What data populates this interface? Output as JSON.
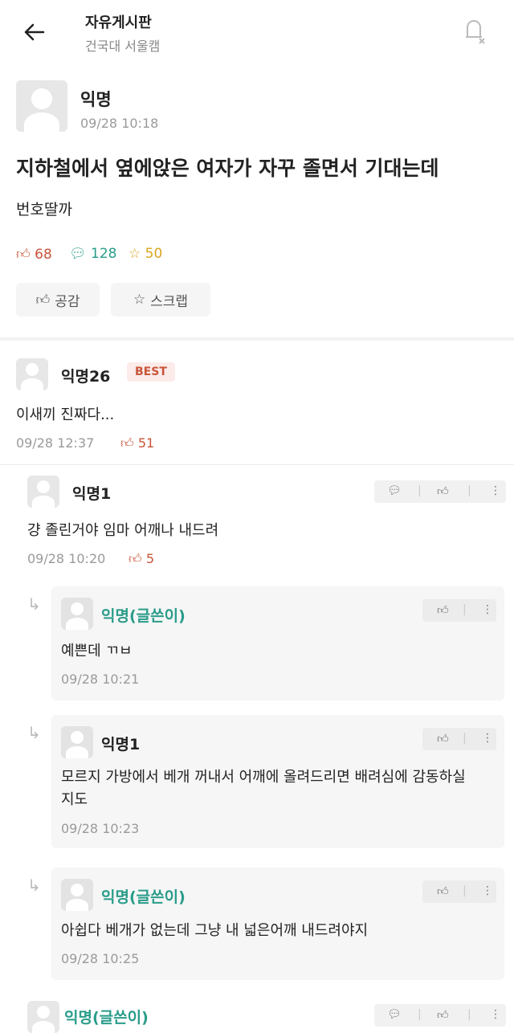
{
  "header": {
    "title": "자유게시판",
    "subtitle": "건국대 서울캠"
  },
  "post": {
    "author": "익명",
    "time": "09/28 10:18",
    "title": "지하철에서 옆에앉은 여자가 자꾸 졸면서 기대는데",
    "body": "번호딸까",
    "likes": "68",
    "comments": "128",
    "scraps": "50",
    "like_button": "공감",
    "scrap_button": "스크랩"
  },
  "comments": [
    {
      "author": "익명26",
      "badge": "BEST",
      "text": "이새끼 진짜다...",
      "time": "09/28 12:37",
      "likes": "51"
    }
  ],
  "replies": [
    {
      "author": "익명1",
      "text": "걍 졸린거야 임마 어깨나 내드려",
      "time": "09/28 10:20",
      "likes": "5"
    },
    {
      "author": "익명(글쓴이)",
      "text": "예쁜데 ㄲㅂ",
      "time": "09/28 10:21"
    },
    {
      "author": "익명1",
      "text": "모르지 가방에서 베개 꺼내서 어깨에 올려드리면 배려심에 감동하실지도",
      "time": "09/28 10:23"
    },
    {
      "author": "익명(글쓴이)",
      "text": "아쉽다 베개가 없는데 그냥 내 넓은어깨 내드려야지",
      "time": "09/28 10:25"
    },
    {
      "author": "익명(글쓴이)"
    }
  ]
}
